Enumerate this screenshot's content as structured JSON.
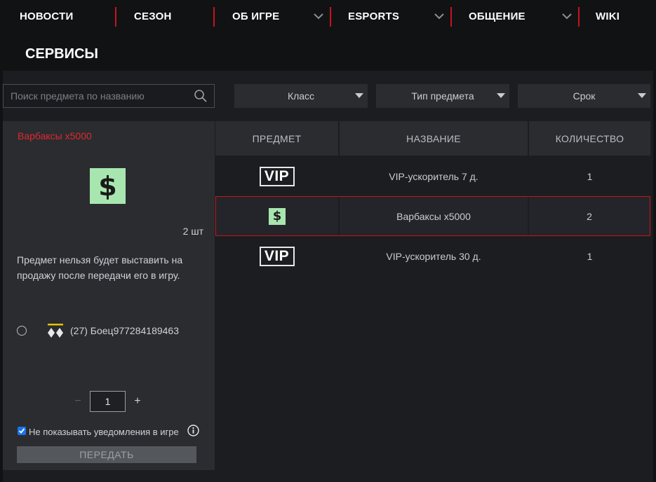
{
  "nav": {
    "items": [
      {
        "label": "НОВОСТИ"
      },
      {
        "label": "СЕЗОН"
      },
      {
        "label": "ОБ ИГРЕ"
      },
      {
        "label": "ESPORTS"
      },
      {
        "label": "ОБЩЕНИЕ"
      },
      {
        "label": "WIKI"
      }
    ]
  },
  "page": {
    "title": "СЕРВИСЫ"
  },
  "filters": {
    "search_placeholder": "Поиск предмета по названию",
    "class_label": "Класс",
    "type_label": "Тип предмета",
    "term_label": "Срок"
  },
  "detail": {
    "title": "Варбаксы x5000",
    "count": "2 шт",
    "note": "Предмет нельзя будет выставить на продажу после передачи его в игру.",
    "player": "(27) Боец977284189463",
    "quantity": "1",
    "minus": "−",
    "plus": "+",
    "checkbox_label": "Не показывать уведомления в игре",
    "checkbox_checked": true,
    "send_label": "ПЕРЕДАТЬ"
  },
  "table": {
    "headers": [
      "ПРЕДМЕТ",
      "НАЗВАНИЕ",
      "КОЛИЧЕСТВО"
    ],
    "rows": [
      {
        "icon": "vip-icon",
        "icon_text": "VIP",
        "name": "VIP-ускоритель 7 д.",
        "qty": "1"
      },
      {
        "icon": "warbucks-icon",
        "icon_text": "$",
        "name": "Варбаксы x5000",
        "qty": "2",
        "selected": true
      },
      {
        "icon": "vip-icon",
        "icon_text": "VIP",
        "name": "VIP-ускоритель 30 д.",
        "qty": "1"
      }
    ]
  },
  "colors": {
    "accent": "#c8141c",
    "warbucks_bg": "#a8e6b0",
    "background": "#111214",
    "panel": "#1c1d20",
    "card": "#2a2c30"
  }
}
